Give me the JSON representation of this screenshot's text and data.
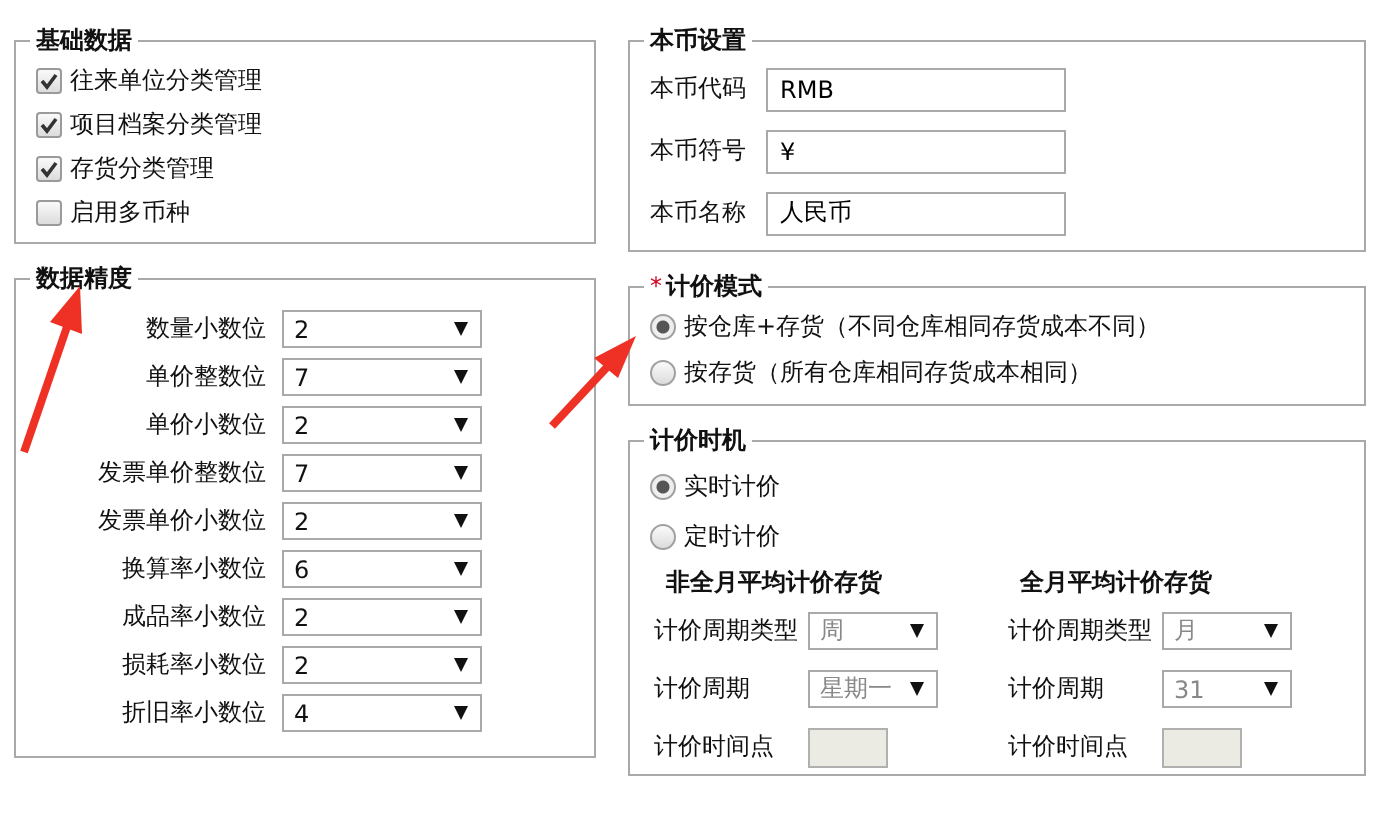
{
  "basic_data": {
    "title": "基础数据",
    "options": [
      {
        "label": "往来单位分类管理",
        "checked": true
      },
      {
        "label": "项目档案分类管理",
        "checked": true
      },
      {
        "label": "存货分类管理",
        "checked": true
      },
      {
        "label": "启用多币种",
        "checked": false
      }
    ]
  },
  "precision": {
    "title": "数据精度",
    "fields": [
      {
        "label": "数量小数位",
        "value": "2"
      },
      {
        "label": "单价整数位",
        "value": "7"
      },
      {
        "label": "单价小数位",
        "value": "2"
      },
      {
        "label": "发票单价整数位",
        "value": "7"
      },
      {
        "label": "发票单价小数位",
        "value": "2"
      },
      {
        "label": "换算率小数位",
        "value": "6"
      },
      {
        "label": "成品率小数位",
        "value": "2"
      },
      {
        "label": "损耗率小数位",
        "value": "2"
      },
      {
        "label": "折旧率小数位",
        "value": "4"
      }
    ]
  },
  "currency": {
    "title": "本币设置",
    "fields": [
      {
        "label": "本币代码",
        "value": "RMB"
      },
      {
        "label": "本币符号",
        "value": "¥"
      },
      {
        "label": "本币名称",
        "value": "人民币"
      }
    ]
  },
  "pricing_mode": {
    "title": "计价模式",
    "required_mark": "*",
    "options": [
      {
        "label": "按仓库+存货（不同仓库相同存货成本不同）",
        "selected": true
      },
      {
        "label": "按存货（所有仓库相同存货成本相同）",
        "selected": false
      }
    ]
  },
  "pricing_timing": {
    "title": "计价时机",
    "options": [
      {
        "label": "实时计价",
        "selected": true
      },
      {
        "label": "定时计价",
        "selected": false
      }
    ],
    "groups": [
      {
        "title": "非全月平均计价存货",
        "fields": [
          {
            "kind": "select",
            "label": "计价周期类型",
            "value": "周",
            "disabled": true
          },
          {
            "kind": "select",
            "label": "计价周期",
            "value": "星期一",
            "disabled": true
          },
          {
            "kind": "input",
            "label": "计价时间点",
            "disabled": true
          }
        ]
      },
      {
        "title": "全月平均计价存货",
        "fields": [
          {
            "kind": "select",
            "label": "计价周期类型",
            "value": "月",
            "disabled": true
          },
          {
            "kind": "select",
            "label": "计价周期",
            "value": "31",
            "disabled": true
          },
          {
            "kind": "input",
            "label": "计价时间点",
            "disabled": true
          }
        ]
      }
    ]
  }
}
